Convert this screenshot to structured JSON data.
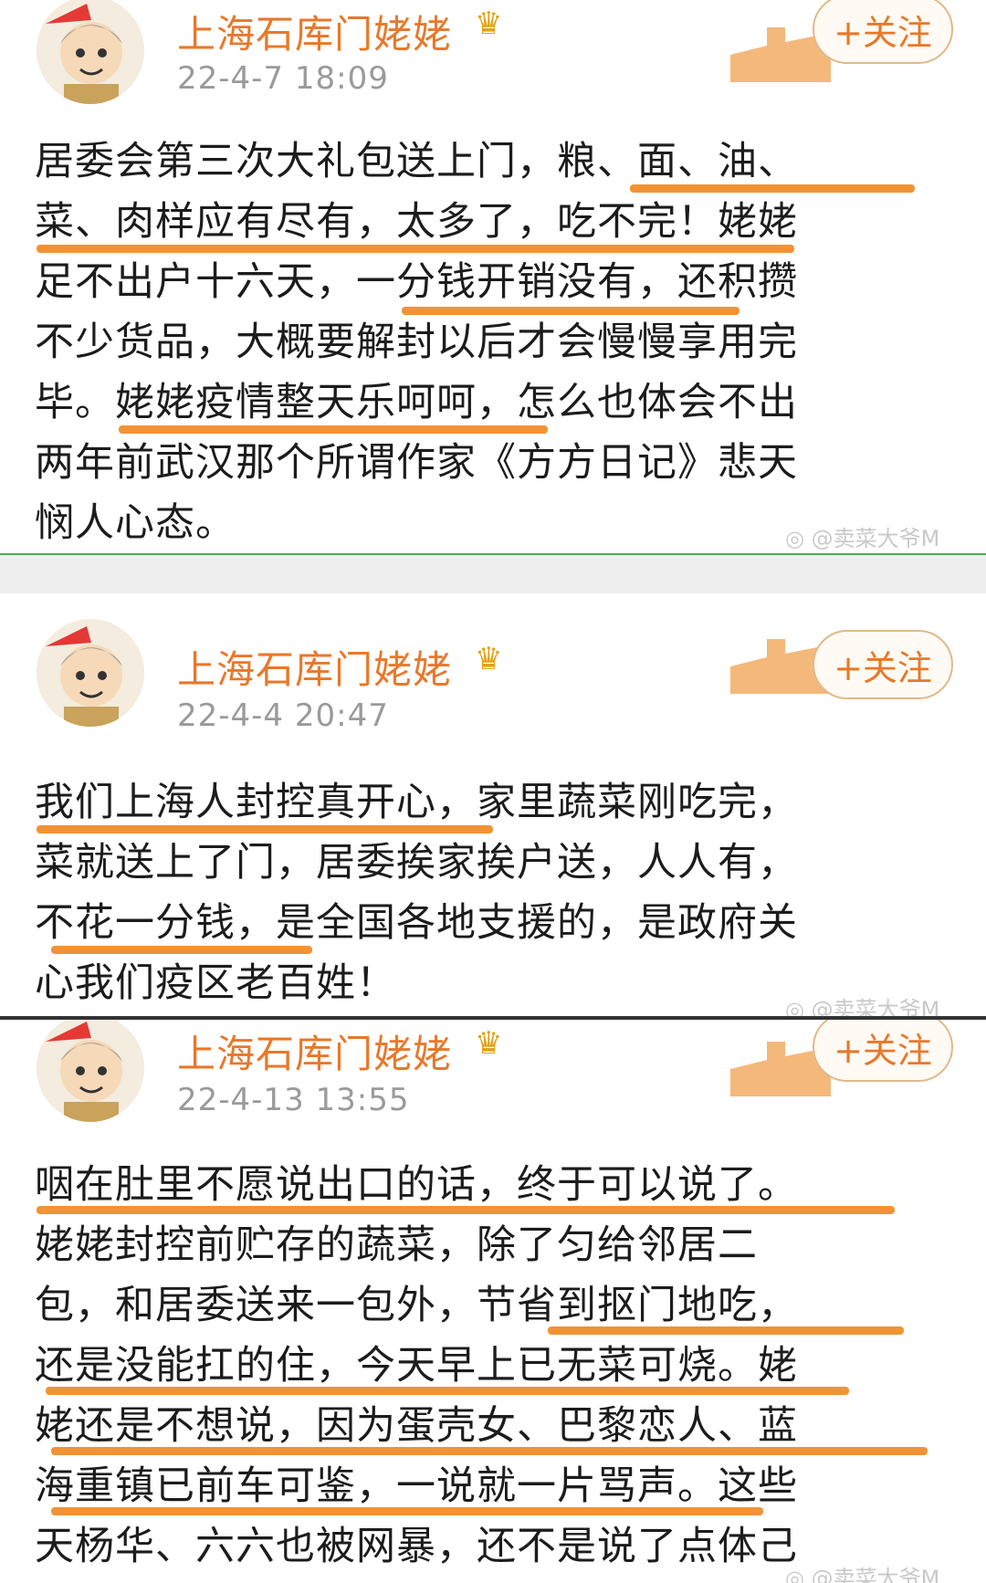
{
  "posts": [
    {
      "author": "上海石库门姥姥",
      "time": "22-4-7 18:09",
      "follow_label": "+关注",
      "lines": [
        "居委会第三次大礼包送上门，粮、面、油、",
        "菜、肉样应有尽有，太多了，吃不完！姥姥",
        "足不出户十六天，一分钱开销没有，还积攒",
        "不少货品，大概要解封以后才会慢慢享用完",
        "毕。姥姥疫情整天乐呵呵，怎么也体会不出",
        "两年前武汉那个所谓作家《方方日记》悲天",
        "悯人心态。"
      ],
      "watermark": "@卖菜大爷M"
    },
    {
      "author": "上海石库门姥姥",
      "time": "22-4-4 20:47",
      "follow_label": "+关注",
      "lines": [
        "我们上海人封控真开心，家里蔬菜刚吃完，",
        "菜就送上了门，居委挨家挨户送，人人有，",
        "不花一分钱，是全国各地支援的，是政府关",
        "心我们疫区老百姓！"
      ],
      "watermark": "@卖菜大爷M"
    },
    {
      "author": "上海石库门姥姥",
      "time": "22-4-13 13:55",
      "follow_label": "+关注",
      "lines": [
        "咽在肚里不愿说出口的话，终于可以说了。",
        "姥姥封控前贮存的蔬菜，除了匀给邻居二",
        "包，和居委送来一包外，节省到抠门地吃，",
        "还是没能扛的住，今天早上已无菜可烧。姥",
        "姥还是不想说，因为蛋壳女、巴黎恋人、蓝",
        "海重镇已前车可鉴，一说就一片骂声。这些",
        "天杨华、六六也被网暴，还不是说了点体己"
      ],
      "watermark": "@卖菜大爷M"
    }
  ],
  "colors": {
    "name": "#e8782a",
    "highlight": "#f08a24",
    "time": "#9a9a9a"
  },
  "icons": {
    "crown": "crown-icon",
    "weibo": "weibo-icon",
    "avatar": "avatar-flag-cartoon"
  }
}
